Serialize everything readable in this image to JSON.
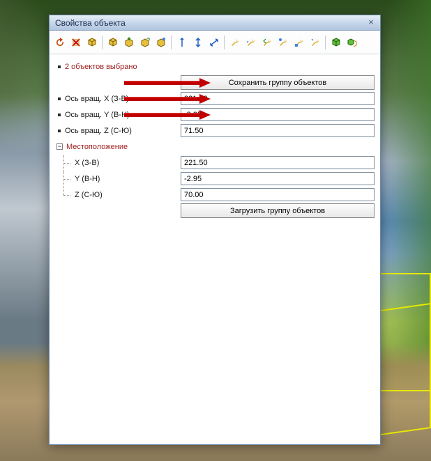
{
  "window": {
    "title": "Свойства объекта"
  },
  "status": {
    "selection": "2 объектов выбрано"
  },
  "buttons": {
    "save_group": "Сохранить группу объектов",
    "load_group": "Загрузить группу объектов"
  },
  "rotation": {
    "x_label": "Ось вращ. X (З-В)",
    "y_label": "Ось вращ. Y (В-Н)",
    "z_label": "Ось вращ. Z (С-Ю)",
    "x": "221.50",
    "y": "-2.95",
    "z": "71.50"
  },
  "position": {
    "section_label": "Местоположение",
    "x_label": "X (З-В)",
    "y_label": "Y (В-Н)",
    "z_label": "Z (С-Ю)",
    "x": "221.50",
    "y": "-2.95",
    "z": "70.00"
  },
  "toolbar_icons": [
    "refresh-icon",
    "delete-icon",
    "cube-icon",
    "cube-add-icon",
    "cube-up-icon",
    "cube-move-icon",
    "cube-link-icon",
    "axis-y-icon",
    "axis-x-icon",
    "axis-z-icon",
    "wrench-a-icon",
    "wrench-b-icon",
    "wrench-arrow-icon",
    "wrench-c-icon",
    "wrench-d-icon",
    "wrench-e-icon",
    "box-green-icon",
    "box-link-icon"
  ]
}
